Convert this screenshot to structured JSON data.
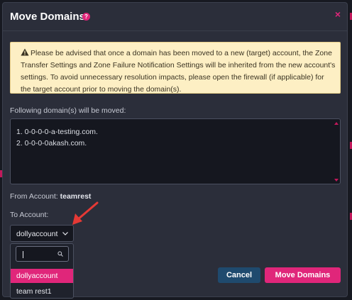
{
  "dialog": {
    "title": "Move Domains",
    "help_icon": "question-circle-icon",
    "close_icon": "close-x-icon",
    "close_symbol": "×"
  },
  "warning": {
    "icon": "warning-triangle-icon",
    "text": "Please be advised that once a domain has been moved to a new (target) account, the Zone Transfer Settings and Zone Failure Notification Settings will be inherited from the new account's settings. To avoid unnecessary resolution impacts, please open the firewall (if applicable) for the target account prior to moving the domain(s)."
  },
  "domains": {
    "label": "Following domain(s) will be moved:",
    "items": [
      "1. 0-0-0-0-a-testing.com.",
      "2. 0-0-0-0akash.com."
    ]
  },
  "from_account": {
    "label": "From Account:",
    "value": "teamrest"
  },
  "to_account": {
    "label": "To Account:",
    "selected": "dollyaccount",
    "search_placeholder": "",
    "options": [
      "dollyaccount",
      "team rest1"
    ]
  },
  "buttons": {
    "cancel": "Cancel",
    "move": "Move Domains"
  },
  "colors": {
    "accent": "#e0267a",
    "cancel_button": "#1f4a6e",
    "modal_bg": "#2b2e3a",
    "warning_bg": "#fdefc4",
    "annotation_arrow": "#e53935"
  }
}
